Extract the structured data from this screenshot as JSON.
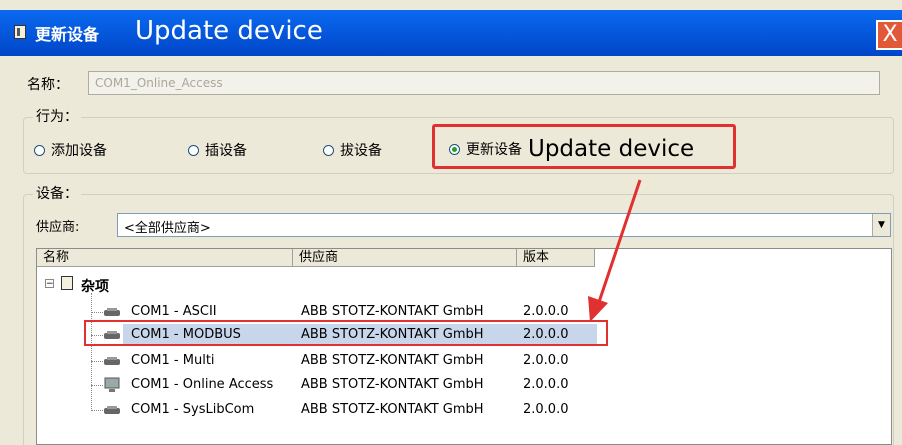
{
  "window": {
    "title_cn": "更新设备",
    "title_en": "Update device",
    "close_glyph": "X"
  },
  "name_field": {
    "label": "名称：",
    "value": "COM1_Online_Access"
  },
  "behavior_group": {
    "label": "行为：",
    "options": [
      {
        "label": "添加设备",
        "selected": false
      },
      {
        "label": "插设备",
        "selected": false
      },
      {
        "label": "拔设备",
        "selected": false
      },
      {
        "label": "更新设备",
        "selected": true
      }
    ],
    "annotation_en": "Update device"
  },
  "device_group": {
    "label": "设备：",
    "vendor_label": "供应商:",
    "vendor_value": "<全部供应商>"
  },
  "device_list": {
    "columns": [
      "名称",
      "供应商",
      "版本"
    ],
    "category": "杂项",
    "expander": "−",
    "rows": [
      {
        "name": "COM1 - ASCII",
        "vendor": "ABB STOTZ-KONTAKT GmbH",
        "version": "2.0.0.0",
        "icon": "serial-plug-icon"
      },
      {
        "name": "COM1 - MODBUS",
        "vendor": "ABB STOTZ-KONTAKT GmbH",
        "version": "2.0.0.0",
        "icon": "serial-plug-icon",
        "selected": true
      },
      {
        "name": "COM1 - Multi",
        "vendor": "ABB STOTZ-KONTAKT GmbH",
        "version": "2.0.0.0",
        "icon": "serial-plug-icon"
      },
      {
        "name": "COM1 - Online Access",
        "vendor": "ABB STOTZ-KONTAKT GmbH",
        "version": "2.0.0.0",
        "icon": "monitor-icon"
      },
      {
        "name": "COM1 - SysLibCom",
        "vendor": "ABB STOTZ-KONTAKT GmbH",
        "version": "2.0.0.0",
        "icon": "serial-plug-icon"
      }
    ]
  },
  "colors": {
    "titlebar": "#0a5ee0",
    "annotation": "#e03030",
    "selection": "#c8d6ec"
  }
}
